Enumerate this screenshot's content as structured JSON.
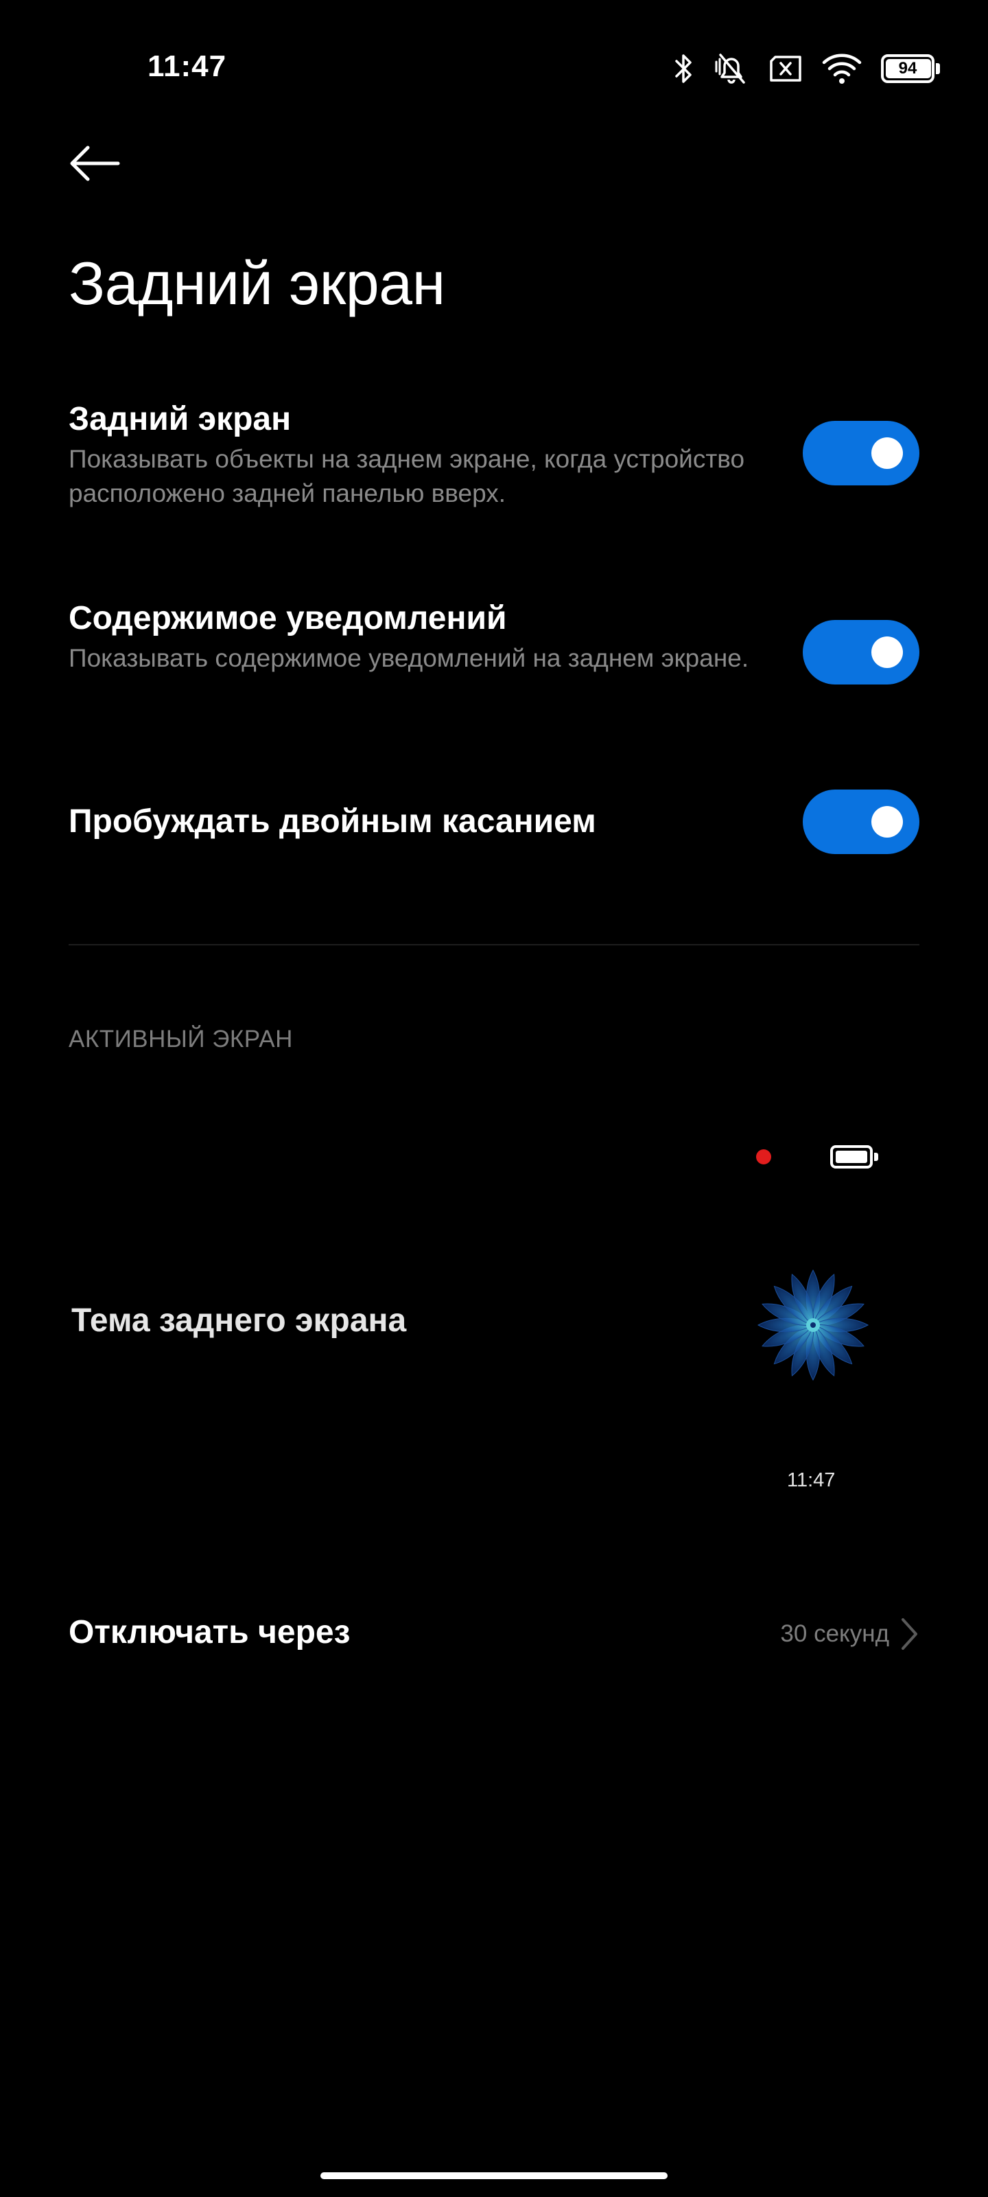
{
  "status_bar": {
    "time": "11:47",
    "battery_level": "94",
    "icons": [
      "bluetooth-icon",
      "vibrate-mute-icon",
      "no-sim-icon",
      "wifi-icon",
      "battery-icon"
    ]
  },
  "header": {
    "back_icon": "back-arrow-icon",
    "title": "Задний экран"
  },
  "settings": [
    {
      "title": "Задний экран",
      "description": "Показывать объекты на заднем экране, когда устройство расположено задней панелью вверх.",
      "enabled": true
    },
    {
      "title": "Содержимое уведомлений",
      "description": "Показывать содержимое уведомлений на заднем экране.",
      "enabled": true
    },
    {
      "title": "Пробуждать двойным касанием",
      "description": "",
      "enabled": true
    }
  ],
  "active_screen": {
    "section_header": "АКТИВНЫЙ ЭКРАН",
    "theme_label": "Тема заднего экрана",
    "preview_time": "11:47",
    "colors": {
      "notification_dot": "#e21d1d",
      "accent": "#0a73e0"
    }
  },
  "timeout": {
    "label": "Отключать через",
    "value": "30 секунд"
  }
}
